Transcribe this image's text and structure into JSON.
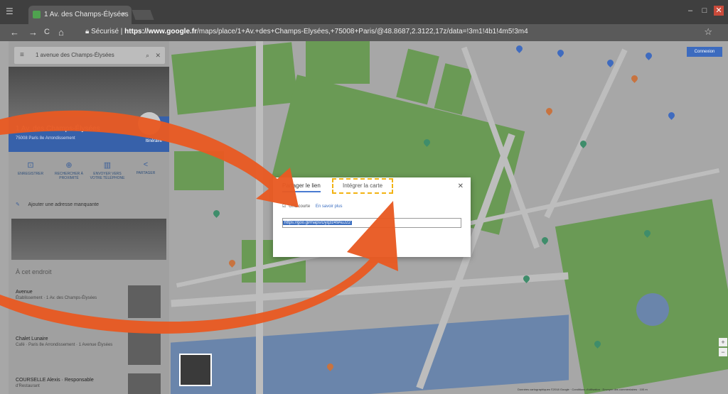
{
  "browser": {
    "tab_title": "1 Av. des Champs-Élysées",
    "tab_close": "×",
    "secure_label": "Sécurisé",
    "url_host": "https://www.google.fr",
    "url_path": "/maps/place/1+Av.+des+Champs-Élysées,+75008+Paris/@48.8687,2.3122,17z/data=!3m1!4b1!4m5!3m4",
    "back": "←",
    "forward": "→",
    "reload": "C",
    "home": "⌂",
    "bookmark_star": "☆",
    "menu": "☰",
    "minimize": "–",
    "maximize": "□",
    "close": "✕"
  },
  "sidebar": {
    "search_value": "1 avenue des Champs-Élysées",
    "menu_icon": "≡",
    "search_icon": "⌕",
    "close_icon": "✕",
    "place_title": "1 Av. des Champs-Élysées",
    "place_subtitle": "75008 Paris 8e Arrondissement",
    "route_label": "Itinéraire",
    "actions": [
      {
        "icon": "⊡",
        "label": "ENREGISTRER"
      },
      {
        "icon": "⊕",
        "label": "RECHERCHER À PROXIMITÉ"
      },
      {
        "icon": "▥",
        "label": "ENVOYER VERS VOTRE TÉLÉPHONE"
      },
      {
        "icon": "<",
        "label": "PARTAGER"
      }
    ],
    "add_label": "Ajouter une adresse manquante",
    "add_icon": "✎",
    "nearby_title": "À cet endroit",
    "nearby_items": [
      {
        "name": "Avenue",
        "desc": "Établissement · 1 Av. des Champs-Élysées"
      },
      {
        "name": "Chalet Lunaire",
        "desc": "Café · Paris 8e Arrondissement · 1 Avenue Élysées"
      },
      {
        "name": "COURSELLE Alexis · Responsable",
        "desc": "d'Restaurant"
      }
    ]
  },
  "map": {
    "controls_button": "Connexion",
    "zoom_in": "+",
    "zoom_out": "−",
    "attribution": "Données cartographiques ©2018 Google · Conditions d'utilisation · Envoyer des commentaires · 100 m"
  },
  "dialog": {
    "tab_share": "Partager le lien",
    "tab_embed": "Intégrer la carte",
    "close": "✕",
    "short_url_label": "URL courte",
    "short_url_link": "En savoir plus",
    "url_value": "https://goo.gl/maps/Dyq3z49AuJ22"
  },
  "colors": {
    "accent": "#3761aa",
    "annotation_arrow": "#e85a22",
    "highlight_border": "#f2b313",
    "park": "#6a9a55",
    "water": "#6a85ab"
  }
}
